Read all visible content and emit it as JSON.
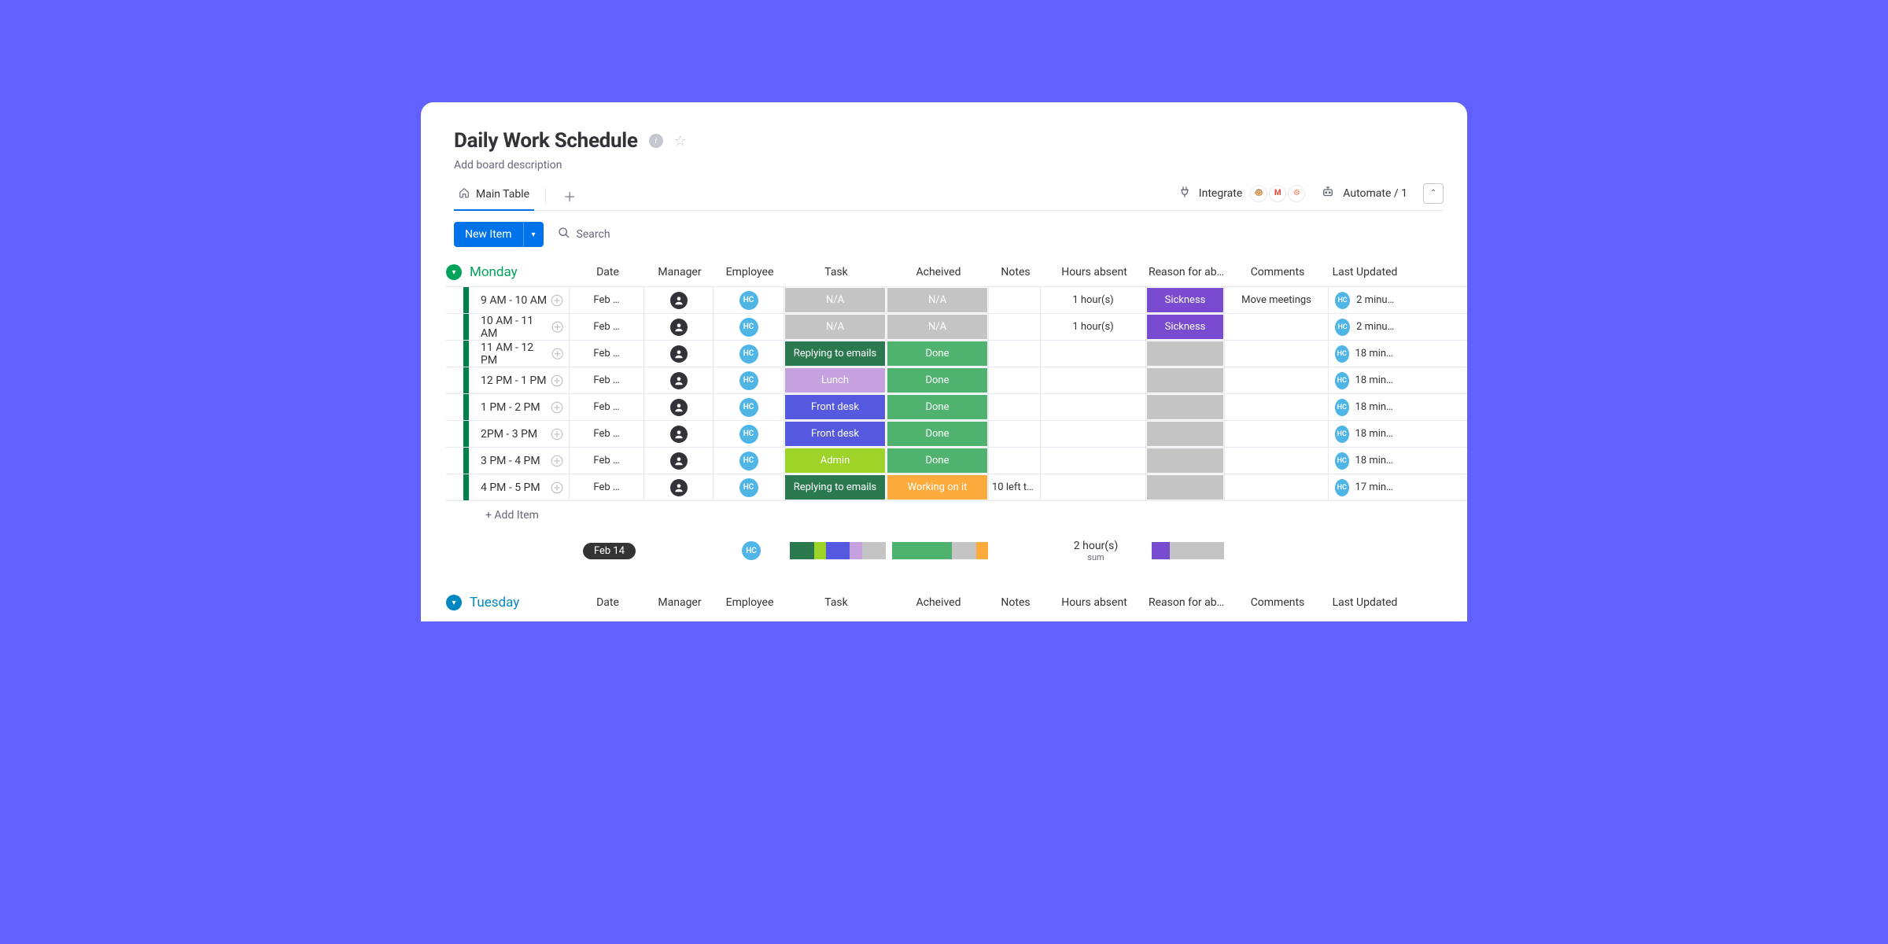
{
  "board": {
    "title": "Daily Work Schedule",
    "description": "Add board description"
  },
  "tabs": {
    "main": "Main Table"
  },
  "topbar": {
    "integrate": "Integrate",
    "automate": "Automate / 1"
  },
  "toolbar": {
    "new_item": "New Item",
    "search": "Search"
  },
  "columns": {
    "date": "Date",
    "manager": "Manager",
    "employee": "Employee",
    "task": "Task",
    "achieved": "Acheived",
    "notes": "Notes",
    "hours_absent": "Hours absent",
    "reason": "Reason for ab…",
    "comments": "Comments",
    "last_updated": "Last Updated"
  },
  "column_widths": {
    "date": 95,
    "manager": 88,
    "employee": 90,
    "task": 130,
    "achieved": 130,
    "notes": 66,
    "hours_absent": 134,
    "reason": 100,
    "comments": 132,
    "last_updated_icon": 30,
    "last_updated_text": 60
  },
  "colors": {
    "monday_group": "#00a359",
    "tuesday_group": "#0086c0",
    "row_bar_monday": "#037f4c",
    "task_na": "#c4c4c4",
    "task_replying": "#2b7a4f",
    "task_lunch": "#c5a1e0",
    "task_frontdesk": "#5559df",
    "task_admin": "#9cd326",
    "ach_na": "#c4c4c4",
    "ach_done": "#4fb36f",
    "ach_working": "#fdab3d",
    "reason_sickness": "#784bd1",
    "reason_blank": "#c4c4c4",
    "avatar_hc": "#4eb5e6"
  },
  "groups": {
    "monday": {
      "name": "Monday",
      "rows": [
        {
          "time": "9 AM - 10 AM",
          "date": "Feb …",
          "task": "N/A",
          "task_color": "#c4c4c4",
          "achieved": "N/A",
          "ach_color": "#c4c4c4",
          "notes": "",
          "hours_absent": "1 hour(s)",
          "reason": "Sickness",
          "reason_color": "#784bd1",
          "comments": "Move meetings",
          "updated": "2 minutes"
        },
        {
          "time": "10 AM - 11 AM",
          "date": "Feb …",
          "task": "N/A",
          "task_color": "#c4c4c4",
          "achieved": "N/A",
          "ach_color": "#c4c4c4",
          "notes": "",
          "hours_absent": "1 hour(s)",
          "reason": "Sickness",
          "reason_color": "#784bd1",
          "comments": "",
          "updated": "2 minutes"
        },
        {
          "time": "11 AM - 12 PM",
          "date": "Feb …",
          "task": "Replying to emails",
          "task_color": "#2b7a4f",
          "achieved": "Done",
          "ach_color": "#4fb36f",
          "notes": "",
          "hours_absent": "",
          "reason": "",
          "reason_color": "#c4c4c4",
          "comments": "",
          "updated": "18 minutes"
        },
        {
          "time": "12 PM - 1 PM",
          "date": "Feb …",
          "task": "Lunch",
          "task_color": "#c5a1e0",
          "achieved": "Done",
          "ach_color": "#4fb36f",
          "notes": "",
          "hours_absent": "",
          "reason": "",
          "reason_color": "#c4c4c4",
          "comments": "",
          "updated": "18 minutes"
        },
        {
          "time": "1 PM - 2 PM",
          "date": "Feb …",
          "task": "Front desk",
          "task_color": "#5559df",
          "achieved": "Done",
          "ach_color": "#4fb36f",
          "notes": "",
          "hours_absent": "",
          "reason": "",
          "reason_color": "#c4c4c4",
          "comments": "",
          "updated": "18 minutes"
        },
        {
          "time": "2PM - 3 PM",
          "date": "Feb …",
          "task": "Front desk",
          "task_color": "#5559df",
          "achieved": "Done",
          "ach_color": "#4fb36f",
          "notes": "",
          "hours_absent": "",
          "reason": "",
          "reason_color": "#c4c4c4",
          "comments": "",
          "updated": "18 minutes"
        },
        {
          "time": "3 PM - 4 PM",
          "date": "Feb …",
          "task": "Admin",
          "task_color": "#9cd326",
          "achieved": "Done",
          "ach_color": "#4fb36f",
          "notes": "",
          "hours_absent": "",
          "reason": "",
          "reason_color": "#c4c4c4",
          "comments": "",
          "updated": "18 minutes"
        },
        {
          "time": "4 PM - 5 PM",
          "date": "Feb …",
          "task": "Replying to emails",
          "task_color": "#2b7a4f",
          "achieved": "Working on it",
          "ach_color": "#fdab3d",
          "notes": "10 left to…",
          "hours_absent": "",
          "reason": "",
          "reason_color": "#c4c4c4",
          "comments": "",
          "updated": "17 minutes"
        }
      ],
      "add_item": "+ Add Item",
      "summary": {
        "date_pill": "Feb 14",
        "hours_absent_total": "2 hour(s)",
        "hours_absent_label": "sum",
        "task_progress": [
          {
            "color": "#2b7a4f",
            "pct": 25
          },
          {
            "color": "#9cd326",
            "pct": 12.5
          },
          {
            "color": "#5559df",
            "pct": 25
          },
          {
            "color": "#c5a1e0",
            "pct": 12.5
          },
          {
            "color": "#c4c4c4",
            "pct": 25
          }
        ],
        "achieved_progress": [
          {
            "color": "#4fb36f",
            "pct": 62.5
          },
          {
            "color": "#c4c4c4",
            "pct": 25
          },
          {
            "color": "#fdab3d",
            "pct": 12.5
          }
        ],
        "reason_progress": [
          {
            "color": "#784bd1",
            "pct": 25
          },
          {
            "color": "#c4c4c4",
            "pct": 75
          }
        ]
      }
    },
    "tuesday": {
      "name": "Tuesday"
    }
  },
  "avatars": {
    "hc_initials": "HC"
  }
}
